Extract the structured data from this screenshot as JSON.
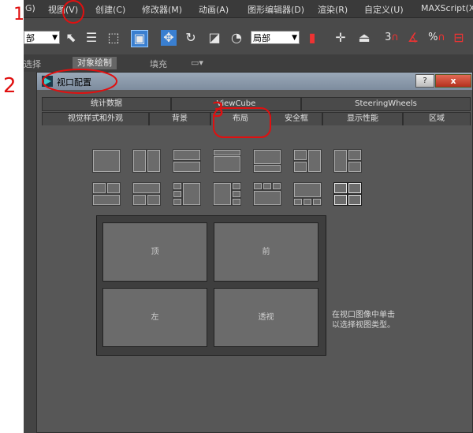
{
  "menu": [
    "G)",
    "视图(V)",
    "创建(C)",
    "修改器(M)",
    "动画(A)",
    "图形编辑器(D)",
    "渲染(R)",
    "自定义(U)",
    "MAXScript(X"
  ],
  "toolbar": {
    "selection_combo": "部",
    "reference_combo": "局部",
    "snap_label": "3",
    "percent_label": "%"
  },
  "ribbon": {
    "tabs": [
      "选择",
      "对象绘制",
      "填充"
    ]
  },
  "dialog": {
    "title": "视口配置",
    "help_label": "?",
    "close_label": "x",
    "tabs_top": [
      "统计数据",
      "ViewCube",
      "SteeringWheels"
    ],
    "tabs_bottom": [
      "视觉样式和外观",
      "背景",
      "布局",
      "安全框",
      "显示性能",
      "区域"
    ],
    "active_tab": "布局",
    "viewports": [
      "顶",
      "前",
      "左",
      "透视"
    ],
    "hint_line1": "在视口图像中单击",
    "hint_line2": "以选择视图类型。"
  },
  "annotations": [
    "1",
    "2",
    "3"
  ],
  "colors": {
    "annotation_red": "#e01010",
    "selected_layout": "#202020",
    "viewport": "#6b6b6b"
  }
}
